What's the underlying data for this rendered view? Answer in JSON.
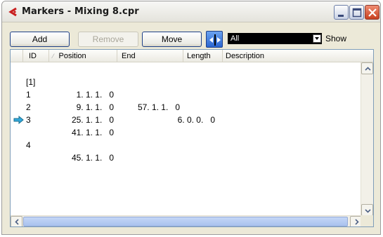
{
  "window": {
    "title": "Markers - Mixing 8.cpr",
    "icon": "cubase-logo-icon",
    "controls": [
      "minimize-icon",
      "maximize-icon",
      "close-icon"
    ]
  },
  "toolbar": {
    "add_label": "Add",
    "remove_label": "Remove",
    "move_label": "Move",
    "cycle_icon": "cycle-marker-icon",
    "filter_value": "All",
    "show_label": "Show"
  },
  "table": {
    "columns": {
      "id": "ID",
      "position": "Position",
      "end": "End",
      "length": "Length",
      "description": "Description"
    },
    "rows": [
      {
        "id": "[1]",
        "position": "1. 1. 1.   0",
        "end": "57. 1. 1.   0",
        "length": "6. 0. 0.   0",
        "description": "",
        "current": false
      },
      {
        "id": "1",
        "position": "9. 1. 1.   0",
        "end": "",
        "length": "",
        "description": "",
        "current": false
      },
      {
        "id": "2",
        "position": "25. 1. 1.   0",
        "end": "",
        "length": "",
        "description": "",
        "current": false
      },
      {
        "id": "3",
        "position": "41. 1. 1.   0",
        "end": "",
        "length": "",
        "description": "",
        "current": false
      },
      {
        "id": "4",
        "position": "45. 1. 1.   0",
        "end": "",
        "length": "",
        "description": "",
        "current": true
      }
    ]
  },
  "colors": {
    "accent": "#2c66d0",
    "current_marker_arrow": "#33aadd",
    "close_button": "#c8401f"
  }
}
